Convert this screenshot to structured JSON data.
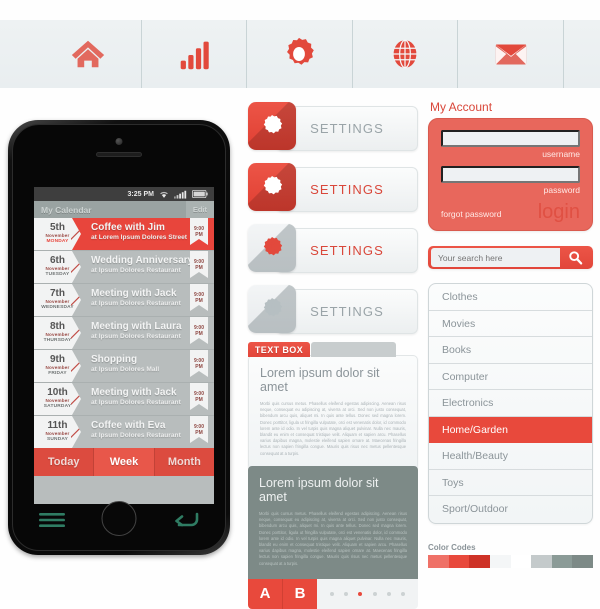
{
  "toolbar": {
    "icons": [
      {
        "name": "home-icon",
        "label": "Home"
      },
      {
        "name": "bar-chart-icon",
        "label": "Statistics"
      },
      {
        "name": "gear-icon",
        "label": "Settings"
      },
      {
        "name": "globe-icon",
        "label": "Web"
      },
      {
        "name": "envelope-icon",
        "label": "Mail"
      }
    ]
  },
  "phone": {
    "status": {
      "time": "3:25 PM",
      "wifi_icon": "wifi-icon",
      "signal_icon": "signal-icon",
      "battery_icon": "battery-icon"
    },
    "header": {
      "title": "My Calendar",
      "edit_label": "Edit"
    },
    "events": [
      {
        "day": "5th",
        "month": "November",
        "dow": "MONDAY",
        "title": "Coffee with Jim",
        "place": "at Lorem Ipsum Dolores Street",
        "time_hour": "9:00",
        "time_ampm": "PM",
        "active": true
      },
      {
        "day": "6th",
        "month": "November",
        "dow": "TUESDAY",
        "title": "Wedding Anniversary",
        "place": "at Ipsum Dolores Restaurant",
        "time_hour": "9:00",
        "time_ampm": "PM",
        "active": false
      },
      {
        "day": "7th",
        "month": "November",
        "dow": "WEDNESDAY",
        "title": "Meeting with Jack",
        "place": "at Ipsum Dolores Restaurant",
        "time_hour": "9:00",
        "time_ampm": "PM",
        "active": false
      },
      {
        "day": "8th",
        "month": "November",
        "dow": "THURSDAY",
        "title": "Meeting with Laura",
        "place": "at Ipsum Dolores Restaurant",
        "time_hour": "9:00",
        "time_ampm": "PM",
        "active": false
      },
      {
        "day": "9th",
        "month": "November",
        "dow": "FRIDAY",
        "title": "Shopping",
        "place": "at Ipsum Dolores Mall",
        "time_hour": "9:00",
        "time_ampm": "PM",
        "active": false
      },
      {
        "day": "10th",
        "month": "November",
        "dow": "SATURDAY",
        "title": "Meeting with Jack",
        "place": "at Ipsum Dolores Restaurant",
        "time_hour": "9:00",
        "time_ampm": "PM",
        "active": false
      },
      {
        "day": "11th",
        "month": "November",
        "dow": "SUNDAY",
        "title": "Coffee with Eva",
        "place": "at Ipsum Dolores Restaurant",
        "time_hour": "9:00",
        "time_ampm": "PM",
        "active": false
      }
    ],
    "tabs": [
      {
        "label": "Today",
        "selected": false
      },
      {
        "label": "Week",
        "selected": true
      },
      {
        "label": "Month",
        "selected": false
      }
    ],
    "softkeys": {
      "menu_icon": "menu-icon",
      "back_icon": "back-arrow-icon"
    }
  },
  "settings_buttons": [
    {
      "label": "SETTINGS",
      "icon": "gear-icon",
      "tile_state": "red",
      "label_state": "grey"
    },
    {
      "label": "SETTINGS",
      "icon": "gear-icon",
      "tile_state": "red",
      "label_state": "red"
    },
    {
      "label": "SETTINGS",
      "icon": "gear-icon",
      "tile_state": "light-red-icon",
      "label_state": "red"
    },
    {
      "label": "SETTINGS",
      "icon": "gear-icon",
      "tile_state": "light-grey-icon",
      "label_state": "grey"
    }
  ],
  "textbox_card": {
    "tab_label": "TEXT BOX",
    "heading": "Lorem ipsum dolor sit amet",
    "body": "Morbi quis cursus metus. Phasellus eleifend egestas adipiscing. Aenean risus neque, consequat eu adipiscing at, viverra at orci. Sed non justo consequat, bibendum arcu quis, aliquet mi. In quis ante tellus. Donec sed magna lorem. Donec porttitor, ligula ut fringilla vulputate, orci est venenatis dolor, id commodo lorem ante id odio. In vel turpis quis magna aliquet pulvinar. Nulla nec mauris, blandit eu enim et consequat tristique velit. Aliquam et sapien arcu. Phasellus varius dapibus magna, molestie eleifend sapien ornare at. Maecenas fringilla lectus non sapien fringilla congue. Mauris quis risus nec metus pellentesque consequat at a turpis."
  },
  "dark_card": {
    "heading": "Lorem ipsum dolor sit amet",
    "body": "Morbi quis cursus metus. Phasellus eleifend egestas adipiscing. Aenean risus neque, consequat eu adipiscing at, viverra at orci. Sed non justo consequat, bibendum arcu quis, aliquet mi. In quis ante tellus. Donec sed magna lorem. Donec porttitor, ligula ut fringilla vulputate, orci est venenatis dolor, id commodo lorem ante id odio. In vel turpis quis magna aliquet pulvinar. Nulla nec mauris, blandit eu enim et consequat tristique velit. Aliquam et sapien arcu. Phasellus varius dapibus magna, molestie eleifend sapien ornare at. Maecenas fringilla lectus non sapien fringilla congue. Mauris quis risus nec metus pellentesque consequat at a turpis.",
    "tab_a": "A",
    "tab_b": "B",
    "dots": 6,
    "active_dot": 3
  },
  "account": {
    "title": "My Account",
    "username_value": "",
    "username_placeholder": "",
    "username_label": "username",
    "password_value": "",
    "password_placeholder": "",
    "password_label": "password",
    "forgot_label": "forgot password",
    "login_label": "login"
  },
  "search": {
    "value": "",
    "placeholder": "Your search here",
    "icon": "search-icon"
  },
  "categories": [
    {
      "label": "Clothes",
      "selected": false
    },
    {
      "label": "Movies",
      "selected": false
    },
    {
      "label": "Books",
      "selected": false
    },
    {
      "label": "Computer",
      "selected": false
    },
    {
      "label": "Electronics",
      "selected": false
    },
    {
      "label": "Home/Garden",
      "selected": true
    },
    {
      "label": "Health/Beauty",
      "selected": false
    },
    {
      "label": "Toys",
      "selected": false
    },
    {
      "label": "Sport/Outdoor",
      "selected": false
    }
  ],
  "color_codes": {
    "title": "Color Codes",
    "swatches": [
      "#ef7167",
      "#e8493c",
      "#ce3227",
      "#f4f6f7",
      "#ffffff",
      "#c4cacb",
      "#8b9b97",
      "#7d8a87"
    ]
  }
}
